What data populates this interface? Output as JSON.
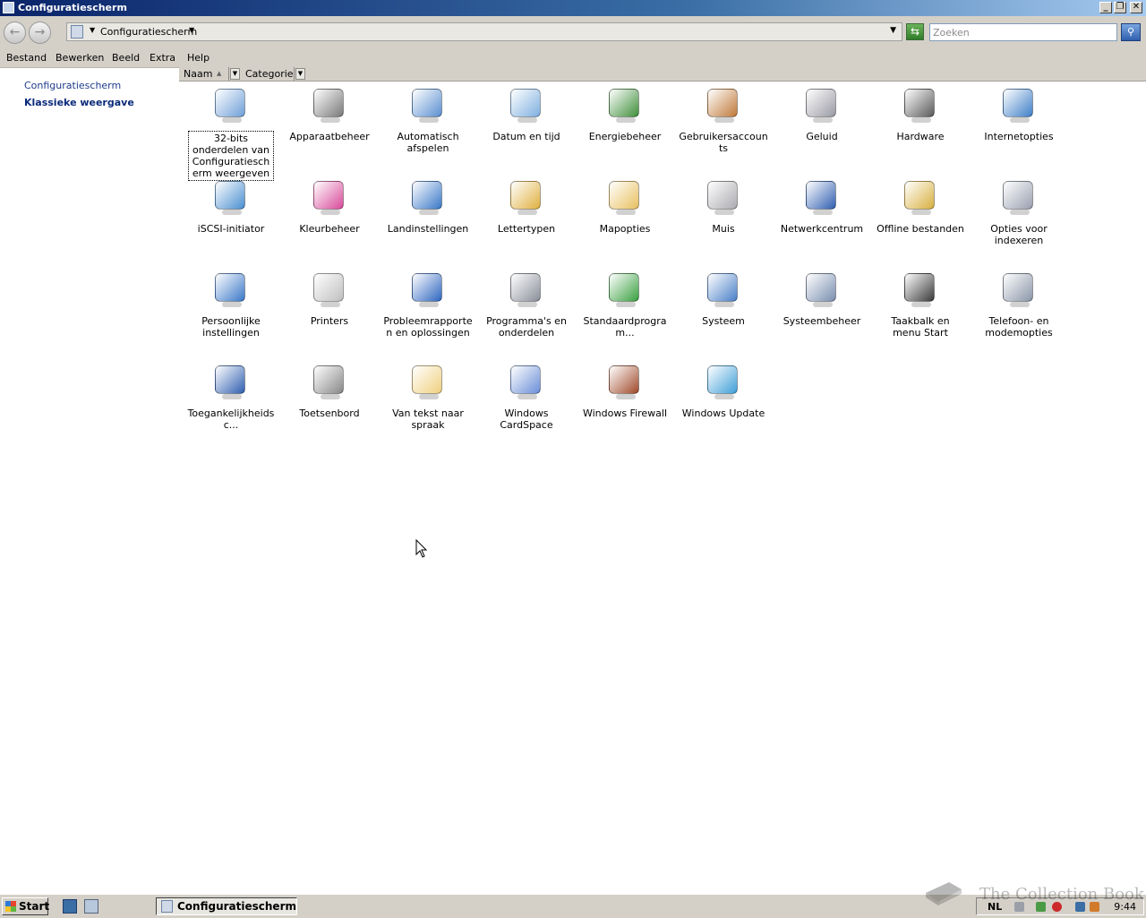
{
  "window": {
    "title": "Configuratiescherm",
    "controls": {
      "minimize": "_",
      "maximize": "❐",
      "close": "✕"
    }
  },
  "address": {
    "crumb": "Configuratiescherm",
    "search_placeholder": "Zoeken"
  },
  "menu": [
    "Bestand",
    "Bewerken",
    "Beeld",
    "Extra",
    "Help"
  ],
  "left_pane": {
    "home_link": "Configuratiescherm",
    "classic_view": "Klassieke weergave"
  },
  "columns": {
    "name": "Naam",
    "category": "Categorie"
  },
  "items": [
    {
      "label": "32-bits onderdelen van Configuratiescherm weergeven",
      "icon": "control-panel-32bit-icon",
      "selected": true
    },
    {
      "label": "Apparaatbeheer",
      "icon": "device-manager-icon"
    },
    {
      "label": "Automatisch afspelen",
      "icon": "autoplay-icon"
    },
    {
      "label": "Datum en tijd",
      "icon": "date-time-icon"
    },
    {
      "label": "Energiebeheer",
      "icon": "power-options-icon"
    },
    {
      "label": "Gebruikersaccounts",
      "icon": "user-accounts-icon"
    },
    {
      "label": "Geluid",
      "icon": "sound-icon"
    },
    {
      "label": "Hardware",
      "icon": "add-hardware-icon"
    },
    {
      "label": "Internetopties",
      "icon": "internet-options-icon"
    },
    {
      "label": "iSCSI-initiator",
      "icon": "iscsi-initiator-icon"
    },
    {
      "label": "Kleurbeheer",
      "icon": "color-management-icon"
    },
    {
      "label": "Landinstellingen",
      "icon": "regional-settings-icon"
    },
    {
      "label": "Lettertypen",
      "icon": "fonts-icon"
    },
    {
      "label": "Mapopties",
      "icon": "folder-options-icon"
    },
    {
      "label": "Muis",
      "icon": "mouse-icon"
    },
    {
      "label": "Netwerkcentrum",
      "icon": "network-center-icon"
    },
    {
      "label": "Offline bestanden",
      "icon": "offline-files-icon"
    },
    {
      "label": "Opties voor indexeren",
      "icon": "indexing-options-icon"
    },
    {
      "label": "Persoonlijke instellingen",
      "icon": "personalization-icon"
    },
    {
      "label": "Printers",
      "icon": "printers-icon"
    },
    {
      "label": "Probleemrapporten en oplossingen",
      "icon": "problem-reports-icon"
    },
    {
      "label": "Programma's en onderdelen",
      "icon": "programs-features-icon"
    },
    {
      "label": "Standaardprogram...",
      "icon": "default-programs-icon"
    },
    {
      "label": "Systeem",
      "icon": "system-icon"
    },
    {
      "label": "Systeembeheer",
      "icon": "administrative-tools-icon"
    },
    {
      "label": "Taakbalk en menu Start",
      "icon": "taskbar-start-menu-icon"
    },
    {
      "label": "Telefoon- en modemopties",
      "icon": "phone-modem-icon"
    },
    {
      "label": "Toegankelijkheidsc...",
      "icon": "ease-of-access-icon"
    },
    {
      "label": "Toetsenbord",
      "icon": "keyboard-icon"
    },
    {
      "label": "Van tekst naar spraak",
      "icon": "text-to-speech-icon"
    },
    {
      "label": "Windows CardSpace",
      "icon": "cardspace-icon"
    },
    {
      "label": "Windows Firewall",
      "icon": "firewall-icon"
    },
    {
      "label": "Windows Update",
      "icon": "windows-update-icon"
    }
  ],
  "taskbar": {
    "start_label": "Start",
    "active_window": "Configuratiescherm",
    "language": "NL",
    "clock": "9:44"
  },
  "watermark": "The Collection Book",
  "colors": {
    "title_bar": "#0a246a",
    "chrome": "#d4d0c8",
    "link": "#1f3c8a"
  }
}
